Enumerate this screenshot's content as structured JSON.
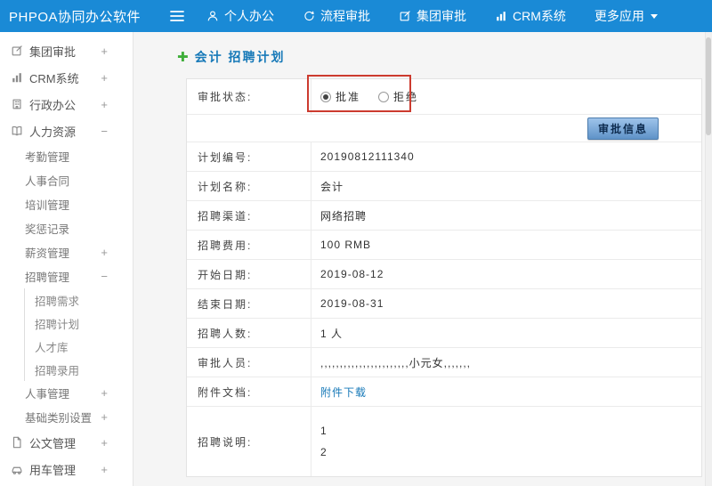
{
  "colors": {
    "topbar-blue": "#1a8ad6",
    "link-blue": "#1779b8",
    "plus-green": "#3fae3a",
    "annotation-red": "#cc3b2f",
    "btn-top": "#9ec3ea",
    "btn-bottom": "#5f93c8"
  },
  "topbar": {
    "app_title": "PHPOA协同办公软件",
    "menu_icon": "hamburger-icon",
    "nav": [
      {
        "label": "个人办公",
        "icon": "person-icon"
      },
      {
        "label": "流程审批",
        "icon": "flow-icon"
      },
      {
        "label": "集团审批",
        "icon": "edit-icon"
      },
      {
        "label": "CRM系统",
        "icon": "chart-icon"
      },
      {
        "label": "更多应用",
        "icon": "",
        "trailing_icon": "caret-down-icon"
      }
    ]
  },
  "sidebar": {
    "items": [
      {
        "label": "集团审批",
        "expander": "+",
        "level": 0,
        "icon": "edit-icon"
      },
      {
        "label": "CRM系统",
        "expander": "+",
        "level": 0,
        "icon": "chart-icon"
      },
      {
        "label": "行政办公",
        "expander": "+",
        "level": 0,
        "icon": "office-icon"
      },
      {
        "label": "人力资源",
        "expander": "−",
        "level": 0,
        "icon": "hr-icon"
      },
      {
        "label": "考勤管理",
        "expander": "",
        "level": 1
      },
      {
        "label": "人事合同",
        "expander": "",
        "level": 1
      },
      {
        "label": "培训管理",
        "expander": "",
        "level": 1
      },
      {
        "label": "奖惩记录",
        "expander": "",
        "level": 1
      },
      {
        "label": "薪资管理",
        "expander": "+",
        "level": 1
      },
      {
        "label": "招聘管理",
        "expander": "−",
        "level": 1
      },
      {
        "label": "招聘需求",
        "expander": "",
        "level": 2
      },
      {
        "label": "招聘计划",
        "expander": "",
        "level": 2
      },
      {
        "label": "人才库",
        "expander": "",
        "level": 2
      },
      {
        "label": "招聘录用",
        "expander": "",
        "level": 2
      },
      {
        "label": "人事管理",
        "expander": "+",
        "level": 1
      },
      {
        "label": "基础类别设置",
        "expander": "+",
        "level": 1
      },
      {
        "label": "公文管理",
        "expander": "+",
        "level": 0,
        "icon": "doc-icon"
      },
      {
        "label": "用车管理",
        "expander": "+",
        "level": 0,
        "icon": "car-icon"
      }
    ]
  },
  "main": {
    "add_icon": "plus-icon",
    "page_title": "会计 招聘计划",
    "approval_status_label": "审批状态:",
    "radio_approve": "批准",
    "radio_reject": "拒绝",
    "radio_selected": "批准",
    "approval_info_button": "审批信息",
    "fields": [
      {
        "label": "计划编号:",
        "value": "20190812111340"
      },
      {
        "label": "计划名称:",
        "value": "会计"
      },
      {
        "label": "招聘渠道:",
        "value": "网络招聘"
      },
      {
        "label": "招聘费用:",
        "value": "100 RMB"
      },
      {
        "label": "开始日期:",
        "value": "2019-08-12"
      },
      {
        "label": "结束日期:",
        "value": "2019-08-31"
      },
      {
        "label": "招聘人数:",
        "value": "1 人"
      },
      {
        "label": "审批人员:",
        "value": ",,,,,,,,,,,,,,,,,,,,,,,小元女,,,,,,,"
      },
      {
        "label": "附件文档:",
        "value": "附件下载",
        "link": true
      },
      {
        "label": "招聘说明:",
        "value": "1\n2",
        "multiline": true
      }
    ]
  }
}
